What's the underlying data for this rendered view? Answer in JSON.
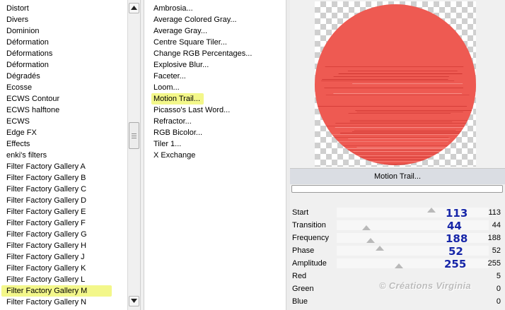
{
  "categories": [
    "Distort",
    "Divers",
    "Dominion",
    "Déformation",
    "Déformations",
    "Déformation",
    "Dégradés",
    "Ecosse",
    "ECWS Contour",
    "ECWS halftone",
    "ECWS",
    "Edge FX",
    "Effects",
    "enki's filters",
    "Filter Factory Gallery A",
    "Filter Factory Gallery B",
    "Filter Factory Gallery C",
    "Filter Factory Gallery D",
    "Filter Factory Gallery E",
    "Filter Factory Gallery F",
    "Filter Factory Gallery G",
    "Filter Factory Gallery H",
    "Filter Factory Gallery J",
    "Filter Factory Gallery K",
    "Filter Factory Gallery L",
    "Filter Factory Gallery M",
    "Filter Factory Gallery N"
  ],
  "selected_category_index": 25,
  "effects": [
    "Ambrosia...",
    "Average Colored Gray...",
    "Average Gray...",
    "Centre Square Tiler...",
    "Change RGB Percentages...",
    "Explosive Blur...",
    "Faceter...",
    "Loom...",
    "Motion Trail...",
    "Picasso's Last Word...",
    "Refractor...",
    "RGB Bicolor...",
    "Tiler 1...",
    "X Exchange"
  ],
  "selected_effect_index": 8,
  "preview": {
    "effect_label": "Motion Trail...",
    "circle_color": "#ee5a52",
    "streak_color": "#c9302c"
  },
  "parameters": [
    {
      "name": "Start",
      "value": "113",
      "big": "113"
    },
    {
      "name": "Transition",
      "value": "44",
      "big": "44"
    },
    {
      "name": "Frequency",
      "value": "188",
      "big": "188"
    },
    {
      "name": "Phase",
      "value": "52",
      "big": "52"
    },
    {
      "name": "Amplitude",
      "value": "255",
      "big": "255"
    },
    {
      "name": "Red",
      "value": "5",
      "big": ""
    },
    {
      "name": "Green",
      "value": "0",
      "big": ""
    },
    {
      "name": "Blue",
      "value": "0",
      "big": ""
    }
  ],
  "watermark": "© Créations Virginia",
  "colors": {
    "highlight": "#f3f78a",
    "big_number": "#1726a8"
  }
}
